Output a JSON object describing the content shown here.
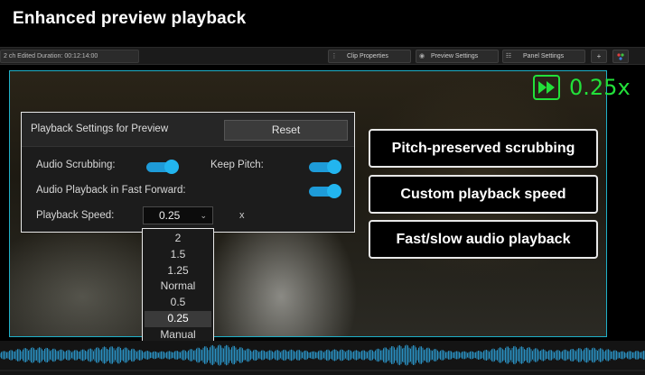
{
  "headline": "Enhanced preview playback",
  "toolbar": {
    "info": "2 ch   Edited Duration: 00:12:14:00",
    "clip_properties": "Clip Properties",
    "preview_settings": "Preview Settings",
    "panel_settings": "Panel Settings",
    "plus_symbol": "+"
  },
  "speed_overlay": {
    "text": "0.25x",
    "color": "#22e03a"
  },
  "panel": {
    "title": "Playback Settings for Preview",
    "reset_label": "Reset",
    "audio_scrubbing_label": "Audio Scrubbing:",
    "audio_scrubbing_on": true,
    "keep_pitch_label": "Keep Pitch:",
    "keep_pitch_on": true,
    "fast_forward_label": "Audio Playback in Fast Forward:",
    "fast_forward_on": true,
    "speed_label": "Playback Speed:",
    "speed_value": "0.25",
    "speed_unit": "x"
  },
  "dropdown": {
    "options": [
      "2",
      "1.5",
      "1.25",
      "Normal",
      "0.5",
      "0.25",
      "Manual"
    ],
    "selected": "0.25"
  },
  "callouts": [
    "Pitch-preserved scrubbing",
    "Custom playback speed",
    "Fast/slow audio playback"
  ],
  "colors": {
    "accent": "#1e9bd8",
    "preview_border": "#1fb0c8",
    "waveform": "#2a8fc0"
  }
}
